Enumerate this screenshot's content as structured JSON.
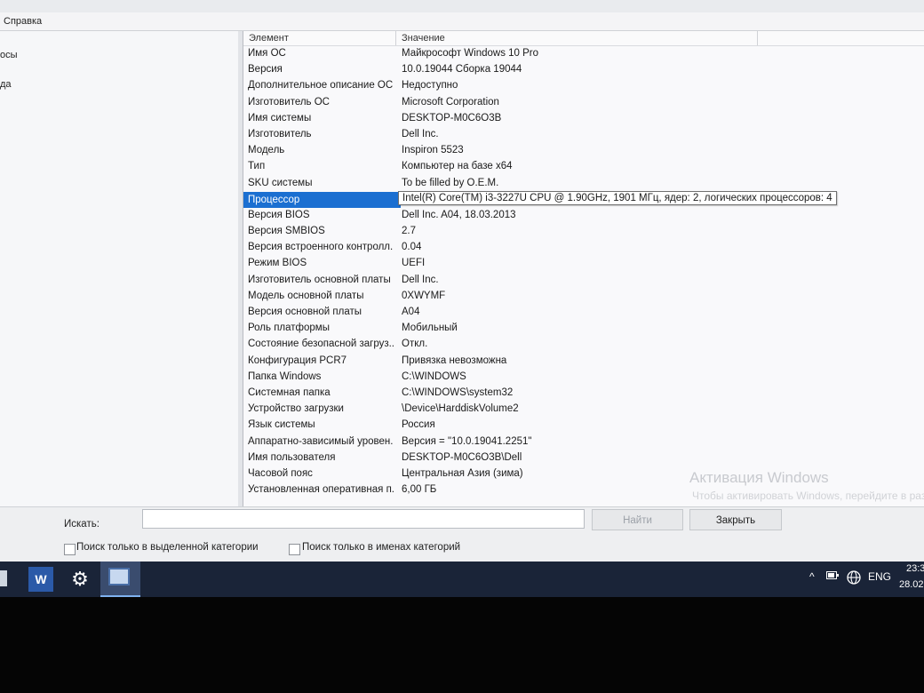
{
  "menubar": {
    "help": "Справка"
  },
  "left_pane": {
    "items": [
      "осы",
      "да"
    ]
  },
  "columns": {
    "element": "Элемент",
    "value": "Значение"
  },
  "rows": [
    {
      "name": "Имя ОС",
      "value": "Майкрософт Windows 10 Pro"
    },
    {
      "name": "Версия",
      "value": "10.0.19044 Сборка 19044"
    },
    {
      "name": "Дополнительное описание ОС",
      "value": "Недоступно"
    },
    {
      "name": "Изготовитель ОС",
      "value": "Microsoft Corporation"
    },
    {
      "name": "Имя системы",
      "value": "DESKTOP-M0C6O3B"
    },
    {
      "name": "Изготовитель",
      "value": "Dell Inc."
    },
    {
      "name": "Модель",
      "value": "Inspiron 5523"
    },
    {
      "name": "Тип",
      "value": "Компьютер на базе x64"
    },
    {
      "name": "SKU системы",
      "value": "To be filled by O.E.M."
    },
    {
      "name": "Процессор",
      "value": "Intel(R) Core(TM) i3-3227U CPU @ 1.90GHz, 1901 МГц, ядер: 2, логических процессоров: 4",
      "selected": true
    },
    {
      "name": "Версия BIOS",
      "value": "Dell Inc. A04, 18.03.2013"
    },
    {
      "name": "Версия SMBIOS",
      "value": "2.7"
    },
    {
      "name": "Версия встроенного контролл...",
      "value": "0.04"
    },
    {
      "name": "Режим BIOS",
      "value": "UEFI"
    },
    {
      "name": "Изготовитель основной платы",
      "value": "Dell Inc."
    },
    {
      "name": "Модель основной платы",
      "value": "0XWYMF"
    },
    {
      "name": "Версия основной платы",
      "value": "A04"
    },
    {
      "name": "Роль платформы",
      "value": "Мобильный"
    },
    {
      "name": "Состояние безопасной загруз...",
      "value": "Откл."
    },
    {
      "name": "Конфигурация PCR7",
      "value": "Привязка невозможна"
    },
    {
      "name": "Папка Windows",
      "value": "C:\\WINDOWS"
    },
    {
      "name": "Системная папка",
      "value": "C:\\WINDOWS\\system32"
    },
    {
      "name": "Устройство загрузки",
      "value": "\\Device\\HarddiskVolume2"
    },
    {
      "name": "Язык системы",
      "value": "Россия"
    },
    {
      "name": "Аппаратно-зависимый уровен...",
      "value": "Версия = \"10.0.19041.2251\""
    },
    {
      "name": "Имя пользователя",
      "value": "DESKTOP-M0C6O3B\\Dell"
    },
    {
      "name": "Часовой пояс",
      "value": "Центральная Азия (зима)"
    },
    {
      "name": "Установленная оперативная п...",
      "value": "6,00 ГБ"
    }
  ],
  "watermark": {
    "title": "Активация Windows",
    "subtitle": "Чтобы активировать Windows, перейдите в раздел «Параметры»."
  },
  "search": {
    "label": "Искать:",
    "value": "",
    "find_button": "Найти",
    "close_button": "Закрыть",
    "checkbox_selected_category": "Поиск только в выделенной категории",
    "checkbox_category_names": "Поиск только в именах категорий"
  },
  "taskbar": {
    "word_icon_letter": "W",
    "lang": "ENG",
    "time": "23:3",
    "date": "28.02."
  }
}
